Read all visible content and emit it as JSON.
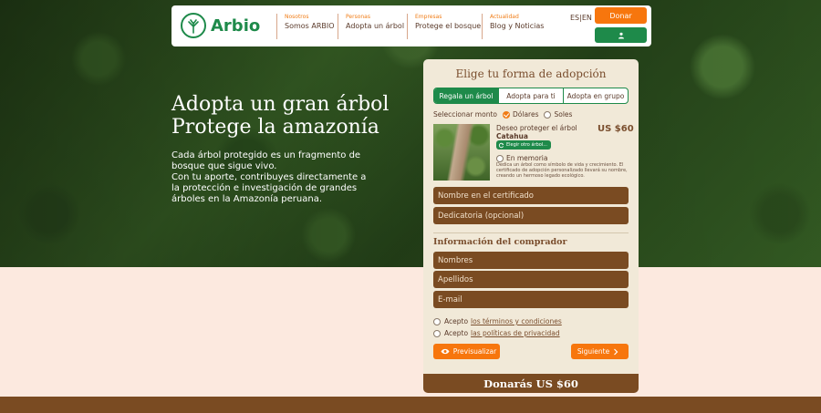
{
  "brand": {
    "name": "Arbio",
    "green": "#1e8a4a",
    "orange": "#f7760d",
    "brown": "#7a4b22"
  },
  "nav": [
    {
      "sub": "Nosotros",
      "main": "Somos ARBIO"
    },
    {
      "sub": "Personas",
      "main": "Adopta un árbol"
    },
    {
      "sub": "Empresas",
      "main": "Protege el bosque"
    },
    {
      "sub": "Actualidad",
      "main": "Blog y Noticias"
    }
  ],
  "header": {
    "lang": "ES|EN",
    "donate_label": "Donar",
    "user_icon": "user-icon"
  },
  "hero": {
    "title_line1": "Adopta un gran árbol",
    "title_line2": "Protege la amazonía",
    "text1": "Cada árbol protegido es un fragmento de bosque que sigue vivo.",
    "text2": "Con tu aporte, contribuyes directamente a la protección e investigación de grandes árboles en la Amazonía peruana."
  },
  "form": {
    "title": "Elige tu forma de adopción",
    "tabs": [
      "Regala un árbol",
      "Adopta para ti",
      "Adopta en grupo"
    ],
    "active_tab": 0,
    "monto_label": "Seleccionar monto",
    "currency_usd": "Dólares",
    "currency_pen": "Soles",
    "selected_currency": "Dólares",
    "tree_label": "Deseo proteger el árbol",
    "tree_name": "Catahua",
    "price": "US $60",
    "other_tree_label": "Elegir otro árbol...",
    "memoria_label": "En memoria",
    "memoria_desc": "Dedica un árbol como símbolo de vida y crecimiento. El certificado de adopción personalizado llevará su nombre, creando un hermoso legado ecológico.",
    "cert_name_placeholder": "Nombre en el certificado",
    "dedication_placeholder": "Dedicatoria (opcional)",
    "buyer_title": "Información del comprador",
    "names_placeholder": "Nombres",
    "surnames_placeholder": "Apellidos",
    "email_placeholder": "E-mail",
    "accept_prefix": "Acepto",
    "terms_link": "los términos y condiciones",
    "privacy_link": "las políticas de privacidad",
    "preview_label": "Previsualizar",
    "next_label": "Siguiente",
    "donate_summary": "Donarás US $60"
  }
}
